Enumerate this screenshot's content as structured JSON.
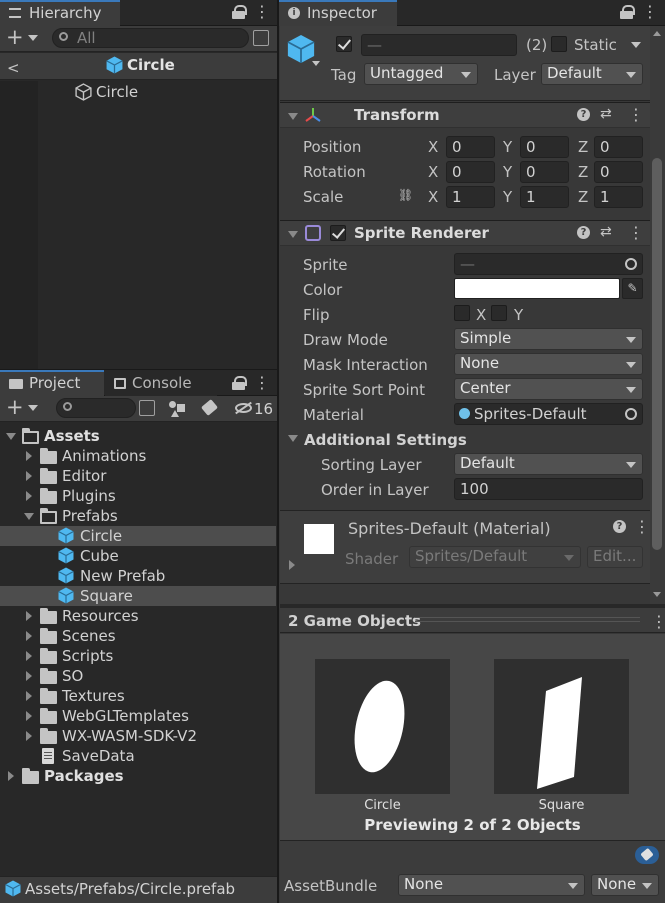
{
  "hierarchy": {
    "tab_label": "Hierarchy",
    "search_placeholder": "All",
    "scene_title": "Circle",
    "items": [
      {
        "label": "Circle"
      }
    ]
  },
  "inspector": {
    "tab_label": "Inspector",
    "object": {
      "name_value": "—",
      "count": "(2)",
      "static_label": "Static",
      "tag_label": "Tag",
      "tag_value": "Untagged",
      "layer_label": "Layer",
      "layer_value": "Default"
    },
    "transform": {
      "title": "Transform",
      "rows": [
        {
          "label": "Position",
          "x": "0",
          "y": "0",
          "z": "0"
        },
        {
          "label": "Rotation",
          "x": "0",
          "y": "0",
          "z": "0"
        },
        {
          "label": "Scale",
          "x": "1",
          "y": "1",
          "z": "1"
        }
      ],
      "axis_x": "X",
      "axis_y": "Y",
      "axis_z": "Z"
    },
    "sprite_renderer": {
      "title": "Sprite Renderer",
      "sprite_label": "Sprite",
      "sprite_value": "—",
      "color_label": "Color",
      "color_value": "#ffffff",
      "flip_label": "Flip",
      "flip_x": "X",
      "flip_y": "Y",
      "draw_mode_label": "Draw Mode",
      "draw_mode_value": "Simple",
      "mask_label": "Mask Interaction",
      "mask_value": "None",
      "sort_point_label": "Sprite Sort Point",
      "sort_point_value": "Center",
      "material_label": "Material",
      "material_value": "Sprites-Default",
      "additional_label": "Additional Settings",
      "sorting_layer_label": "Sorting Layer",
      "sorting_layer_value": "Default",
      "order_label": "Order in Layer",
      "order_value": "100"
    },
    "material": {
      "title": "Sprites-Default (Material)",
      "shader_label": "Shader",
      "shader_value": "Sprites/Default",
      "edit_label": "Edit..."
    },
    "preview": {
      "title": "2 Game Objects",
      "items": [
        {
          "label": "Circle"
        },
        {
          "label": "Square"
        }
      ],
      "caption": "Previewing 2 of 2 Objects"
    },
    "assetbundle": {
      "label": "AssetBundle",
      "value": "None",
      "variant": "None"
    }
  },
  "project": {
    "tab_label": "Project",
    "console_tab_label": "Console",
    "hidden_count": "16",
    "tree": [
      {
        "label": "Assets"
      },
      {
        "label": "Animations"
      },
      {
        "label": "Editor"
      },
      {
        "label": "Plugins"
      },
      {
        "label": "Prefabs"
      },
      {
        "label": "Circle"
      },
      {
        "label": "Cube"
      },
      {
        "label": "New Prefab"
      },
      {
        "label": "Square"
      },
      {
        "label": "Resources"
      },
      {
        "label": "Scenes"
      },
      {
        "label": "Scripts"
      },
      {
        "label": "SO"
      },
      {
        "label": "Textures"
      },
      {
        "label": "WebGLTemplates"
      },
      {
        "label": "WX-WASM-SDK-V2"
      },
      {
        "label": "SaveData"
      },
      {
        "label": "Packages"
      }
    ],
    "status_path": "Assets/Prefabs/Circle.prefab"
  },
  "colors": {
    "accent": "#3a79bb",
    "prefab_icon": "#4fb8f0",
    "panel_bg": "#383838",
    "window_bg": "#282828"
  }
}
